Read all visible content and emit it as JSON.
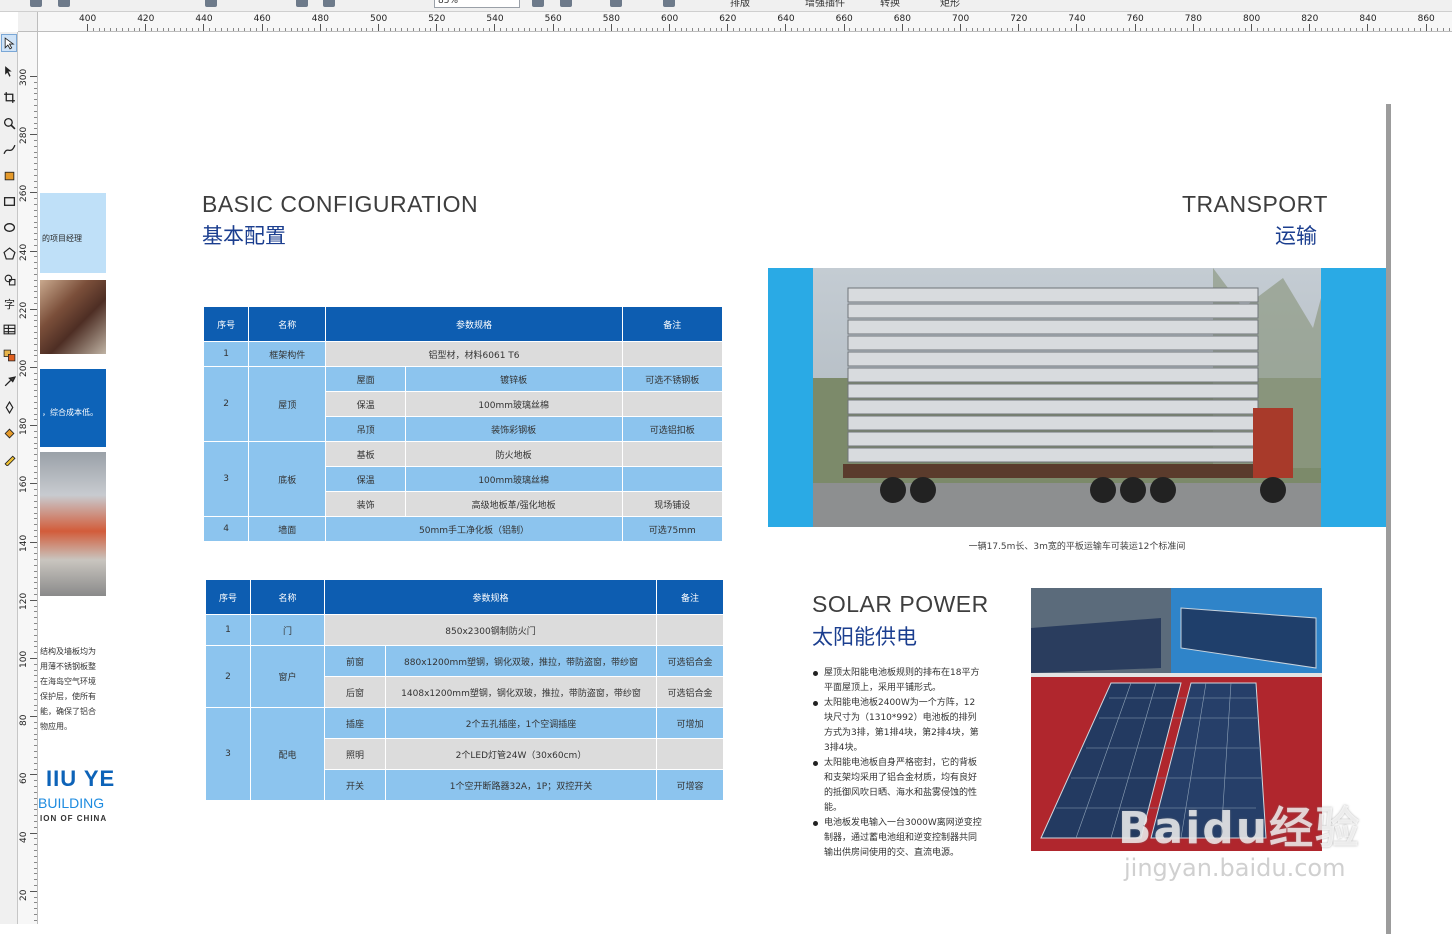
{
  "toolbar": {
    "zoom_value": "85%",
    "buttons": [
      "排版",
      "增强插件",
      "转换",
      "矩形"
    ]
  },
  "ruler_h": {
    "labels": [
      "400",
      "420",
      "440",
      "460",
      "480",
      "500",
      "520",
      "540",
      "560",
      "580",
      "600",
      "620",
      "640",
      "660",
      "680",
      "700",
      "720",
      "740",
      "760",
      "780",
      "800",
      "820",
      "840",
      "860"
    ]
  },
  "ruler_v": {
    "labels": [
      "300",
      "280",
      "260",
      "240",
      "220",
      "200",
      "180",
      "160",
      "140",
      "120",
      "100",
      "80",
      "60",
      "40",
      "20"
    ]
  },
  "left_page": {
    "light_block_text": "的项目经理",
    "dark_block_text": "，综合成本低。",
    "text_lines": [
      "结构及墙板均为",
      "用薄不锈钢板整",
      "在海岛空气环境",
      "保护层，使所有",
      "能，确保了铝合",
      "物应用。"
    ],
    "logo_line1": "IIU YE",
    "logo_line2": "BUILDING",
    "logo_line3": "ION OF CHINA"
  },
  "basic": {
    "title_en": "BASIC CONFIGURATION",
    "title_cn": "基本配置",
    "headers": [
      "序号",
      "名称",
      "参数规格",
      "备注"
    ],
    "rows": [
      {
        "no": "1",
        "name": "框架构件",
        "spec": "铝型材，材料6061 T6",
        "note": ""
      },
      {
        "no": "2",
        "name": "屋顶",
        "sub": [
          {
            "part": "屋面",
            "spec": "镀锌板",
            "note": "可选不锈钢板"
          },
          {
            "part": "保温",
            "spec": "100mm玻璃丝棉",
            "note": ""
          },
          {
            "part": "吊顶",
            "spec": "装饰彩钢板",
            "note": "可选铝扣板"
          }
        ]
      },
      {
        "no": "3",
        "name": "底板",
        "sub": [
          {
            "part": "基板",
            "spec": "防火地板",
            "note": ""
          },
          {
            "part": "保温",
            "spec": "100mm玻璃丝棉",
            "note": ""
          },
          {
            "part": "装饰",
            "spec": "高级地板革/强化地板",
            "note": "现场铺设"
          }
        ]
      },
      {
        "no": "4",
        "name": "墙面",
        "spec": "50mm手工净化板（铝制）",
        "note": "可选75mm"
      }
    ]
  },
  "equip": {
    "headers": [
      "序号",
      "名称",
      "参数规格",
      "备注"
    ],
    "rows": [
      {
        "no": "1",
        "name": "门",
        "spec": "850x2300钢制防火门",
        "note": ""
      },
      {
        "no": "2",
        "name": "窗户",
        "sub": [
          {
            "part": "前窗",
            "spec": "880x1200mm塑钢，钢化双玻，推拉，带防盗窗，带纱窗",
            "note": "可选铝合金"
          },
          {
            "part": "后窗",
            "spec": "1408x1200mm塑钢，钢化双玻，推拉，带防盗窗，带纱窗",
            "note": "可选铝合金"
          }
        ]
      },
      {
        "no": "3",
        "name": "配电",
        "sub": [
          {
            "part": "插座",
            "spec": "2个五孔插座，1个空调插座",
            "note": "可增加"
          },
          {
            "part": "照明",
            "spec": "2个LED灯管24W（30x60cm）",
            "note": ""
          },
          {
            "part": "开关",
            "spec": "1个空开断路器32A，1P；双控开关",
            "note": "可增容"
          }
        ]
      }
    ]
  },
  "transport": {
    "title_en": "TRANSPORT",
    "title_cn": "运输",
    "caption": "一辆17.5m长、3m宽的平板运输车可装运12个标准间"
  },
  "solar": {
    "title_en": "SOLAR POWER",
    "title_cn": "太阳能供电",
    "bullets": [
      "屋顶太阳能电池板规则的排布在18平方平面屋顶上，采用平铺形式。",
      "太阳能电池板2400W为一个方阵，12块尺寸为（1310*992）电池板的排列方式为3排，第1排4块，第2排4块，第3排4块。",
      "太阳能电池板自身严格密封，它的背板和支架均采用了铝合金材质，均有良好的抵御风吹日晒、海水和盐雾侵蚀的性能。",
      "电池板发电输入一台3000W离网逆变控制器，通过蓄电池组和逆变控制器共同输出供房间使用的交、直流电源。"
    ]
  },
  "watermark": {
    "line1": "Baidu经验",
    "line2": "jingyan.baidu.com"
  },
  "colors": {
    "header_blue": "#0d5db1",
    "cell_blue": "#8cc4ee",
    "cell_gray": "#dcdcdc",
    "sky_blue": "#2aaae5",
    "title_blue": "#1b3e8f"
  }
}
